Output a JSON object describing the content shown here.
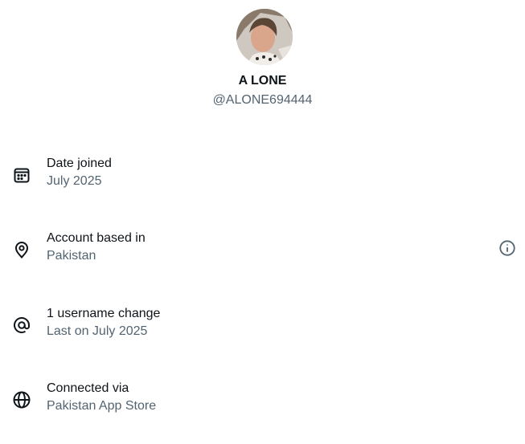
{
  "profile": {
    "display_name": "A LONE",
    "handle": "@ALONE694444",
    "avatar_icon": "profile-photo"
  },
  "rows": [
    {
      "label": "Date joined",
      "value": "July 2025",
      "icon": "calendar-icon"
    },
    {
      "label": "Account based in",
      "value": "Pakistan",
      "icon": "location-pin-icon",
      "info_icon": "info-icon"
    },
    {
      "label": "1 username change",
      "value": "Last on July 2025",
      "icon": "at-sign-icon"
    },
    {
      "label": "Connected via",
      "value": "Pakistan App Store",
      "icon": "globe-icon"
    }
  ],
  "colors": {
    "primary_text": "#0f1419",
    "secondary_text": "#536471",
    "background": "#ffffff"
  }
}
